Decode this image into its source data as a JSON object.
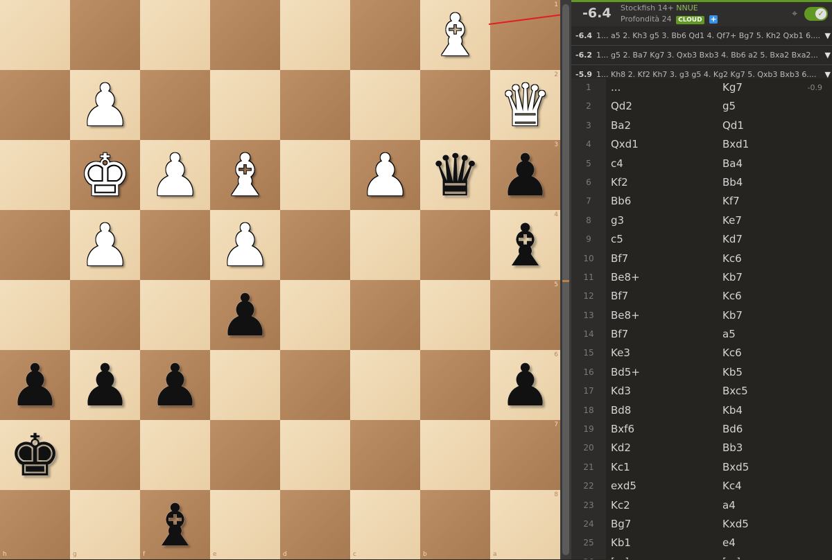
{
  "board": {
    "files": [
      "h",
      "g",
      "f",
      "e",
      "d",
      "c",
      "b",
      "a"
    ],
    "ranks": [
      "1",
      "2",
      "3",
      "4",
      "5",
      "6",
      "7",
      "8"
    ],
    "pieces": [
      {
        "square": "b1",
        "piece": "bishop",
        "color": "white"
      },
      {
        "square": "g2",
        "piece": "pawn",
        "color": "white"
      },
      {
        "square": "a2",
        "piece": "queen",
        "color": "white"
      },
      {
        "square": "g3",
        "piece": "king",
        "color": "white"
      },
      {
        "square": "f3",
        "piece": "pawn",
        "color": "white"
      },
      {
        "square": "e3",
        "piece": "bishop",
        "color": "white"
      },
      {
        "square": "c3",
        "piece": "pawn",
        "color": "white"
      },
      {
        "square": "b3",
        "piece": "queen",
        "color": "black"
      },
      {
        "square": "a3",
        "piece": "pawn",
        "color": "black"
      },
      {
        "square": "g4",
        "piece": "pawn",
        "color": "white"
      },
      {
        "square": "e4",
        "piece": "pawn",
        "color": "white"
      },
      {
        "square": "a4",
        "piece": "bishop",
        "color": "black"
      },
      {
        "square": "e5",
        "piece": "pawn",
        "color": "black"
      },
      {
        "square": "h6",
        "piece": "pawn",
        "color": "black"
      },
      {
        "square": "g6",
        "piece": "pawn",
        "color": "black"
      },
      {
        "square": "f6",
        "piece": "pawn",
        "color": "black"
      },
      {
        "square": "a6",
        "piece": "pawn",
        "color": "black"
      },
      {
        "square": "h7",
        "piece": "king",
        "color": "black"
      },
      {
        "square": "f8",
        "piece": "bishop",
        "color": "black"
      }
    ],
    "light_color": "#f0d9b5",
    "dark_color": "#b58863"
  },
  "engine": {
    "score": "-6.4",
    "name": "Stockfish 14+",
    "nnue": "NNUE",
    "depth_label": "Profondità 24",
    "cloud_label": "CLOUD",
    "plus_label": "+",
    "target_icon": "⌖",
    "toggle_icon": "✓",
    "accent_color": "#629924"
  },
  "pvs": [
    {
      "score": "-6.4",
      "moves": "1... a5 2. Kh3 g5 3. Bb6 Qd1 4. Qf7+ Bg7 5. Kh2 Qxb1 6....",
      "arrow": "▼"
    },
    {
      "score": "-6.2",
      "moves": "1... g5 2. Ba7 Kg7 3. Qxb3 Bxb3 4. Bb6 a2 5. Bxa2 Bxa2...",
      "arrow": "▼"
    },
    {
      "score": "-5.9",
      "moves": "1... Kh8 2. Kf2 Kh7 3. g3 g5 4. Kg2 Kg7 5. Qxb3 Bxb3 6....",
      "arrow": "▼"
    }
  ],
  "moves": [
    {
      "n": "1",
      "w": "...",
      "b": "Kg7",
      "eval": "-0.9"
    },
    {
      "n": "2",
      "w": "Qd2",
      "b": "g5",
      "eval": ""
    },
    {
      "n": "3",
      "w": "Ba2",
      "b": "Qd1",
      "eval": ""
    },
    {
      "n": "4",
      "w": "Qxd1",
      "b": "Bxd1",
      "eval": ""
    },
    {
      "n": "5",
      "w": "c4",
      "b": "Ba4",
      "eval": ""
    },
    {
      "n": "6",
      "w": "Kf2",
      "b": "Bb4",
      "eval": ""
    },
    {
      "n": "7",
      "w": "Bb6",
      "b": "Kf7",
      "eval": ""
    },
    {
      "n": "8",
      "w": "g3",
      "b": "Ke7",
      "eval": ""
    },
    {
      "n": "9",
      "w": "c5",
      "b": "Kd7",
      "eval": ""
    },
    {
      "n": "10",
      "w": "Bf7",
      "b": "Kc6",
      "eval": ""
    },
    {
      "n": "11",
      "w": "Be8+",
      "b": "Kb7",
      "eval": ""
    },
    {
      "n": "12",
      "w": "Bf7",
      "b": "Kc6",
      "eval": ""
    },
    {
      "n": "13",
      "w": "Be8+",
      "b": "Kb7",
      "eval": ""
    },
    {
      "n": "14",
      "w": "Bf7",
      "b": "a5",
      "eval": ""
    },
    {
      "n": "15",
      "w": "Ke3",
      "b": "Kc6",
      "eval": ""
    },
    {
      "n": "16",
      "w": "Bd5+",
      "b": "Kb5",
      "eval": ""
    },
    {
      "n": "17",
      "w": "Kd3",
      "b": "Bxc5",
      "eval": ""
    },
    {
      "n": "18",
      "w": "Bd8",
      "b": "Kb4",
      "eval": ""
    },
    {
      "n": "19",
      "w": "Bxf6",
      "b": "Bd6",
      "eval": ""
    },
    {
      "n": "20",
      "w": "Kd2",
      "b": "Bb3",
      "eval": ""
    },
    {
      "n": "21",
      "w": "Kc1",
      "b": "Bxd5",
      "eval": ""
    },
    {
      "n": "22",
      "w": "exd5",
      "b": "Kc4",
      "eval": ""
    },
    {
      "n": "23",
      "w": "Kc2",
      "b": "a4",
      "eval": ""
    },
    {
      "n": "24",
      "w": "Bg7",
      "b": "Kxd5",
      "eval": ""
    },
    {
      "n": "25",
      "w": "Kb1",
      "b": "e4",
      "eval": ""
    },
    {
      "n": "26",
      "w": "[...]",
      "b": "[...]",
      "eval": ""
    }
  ]
}
